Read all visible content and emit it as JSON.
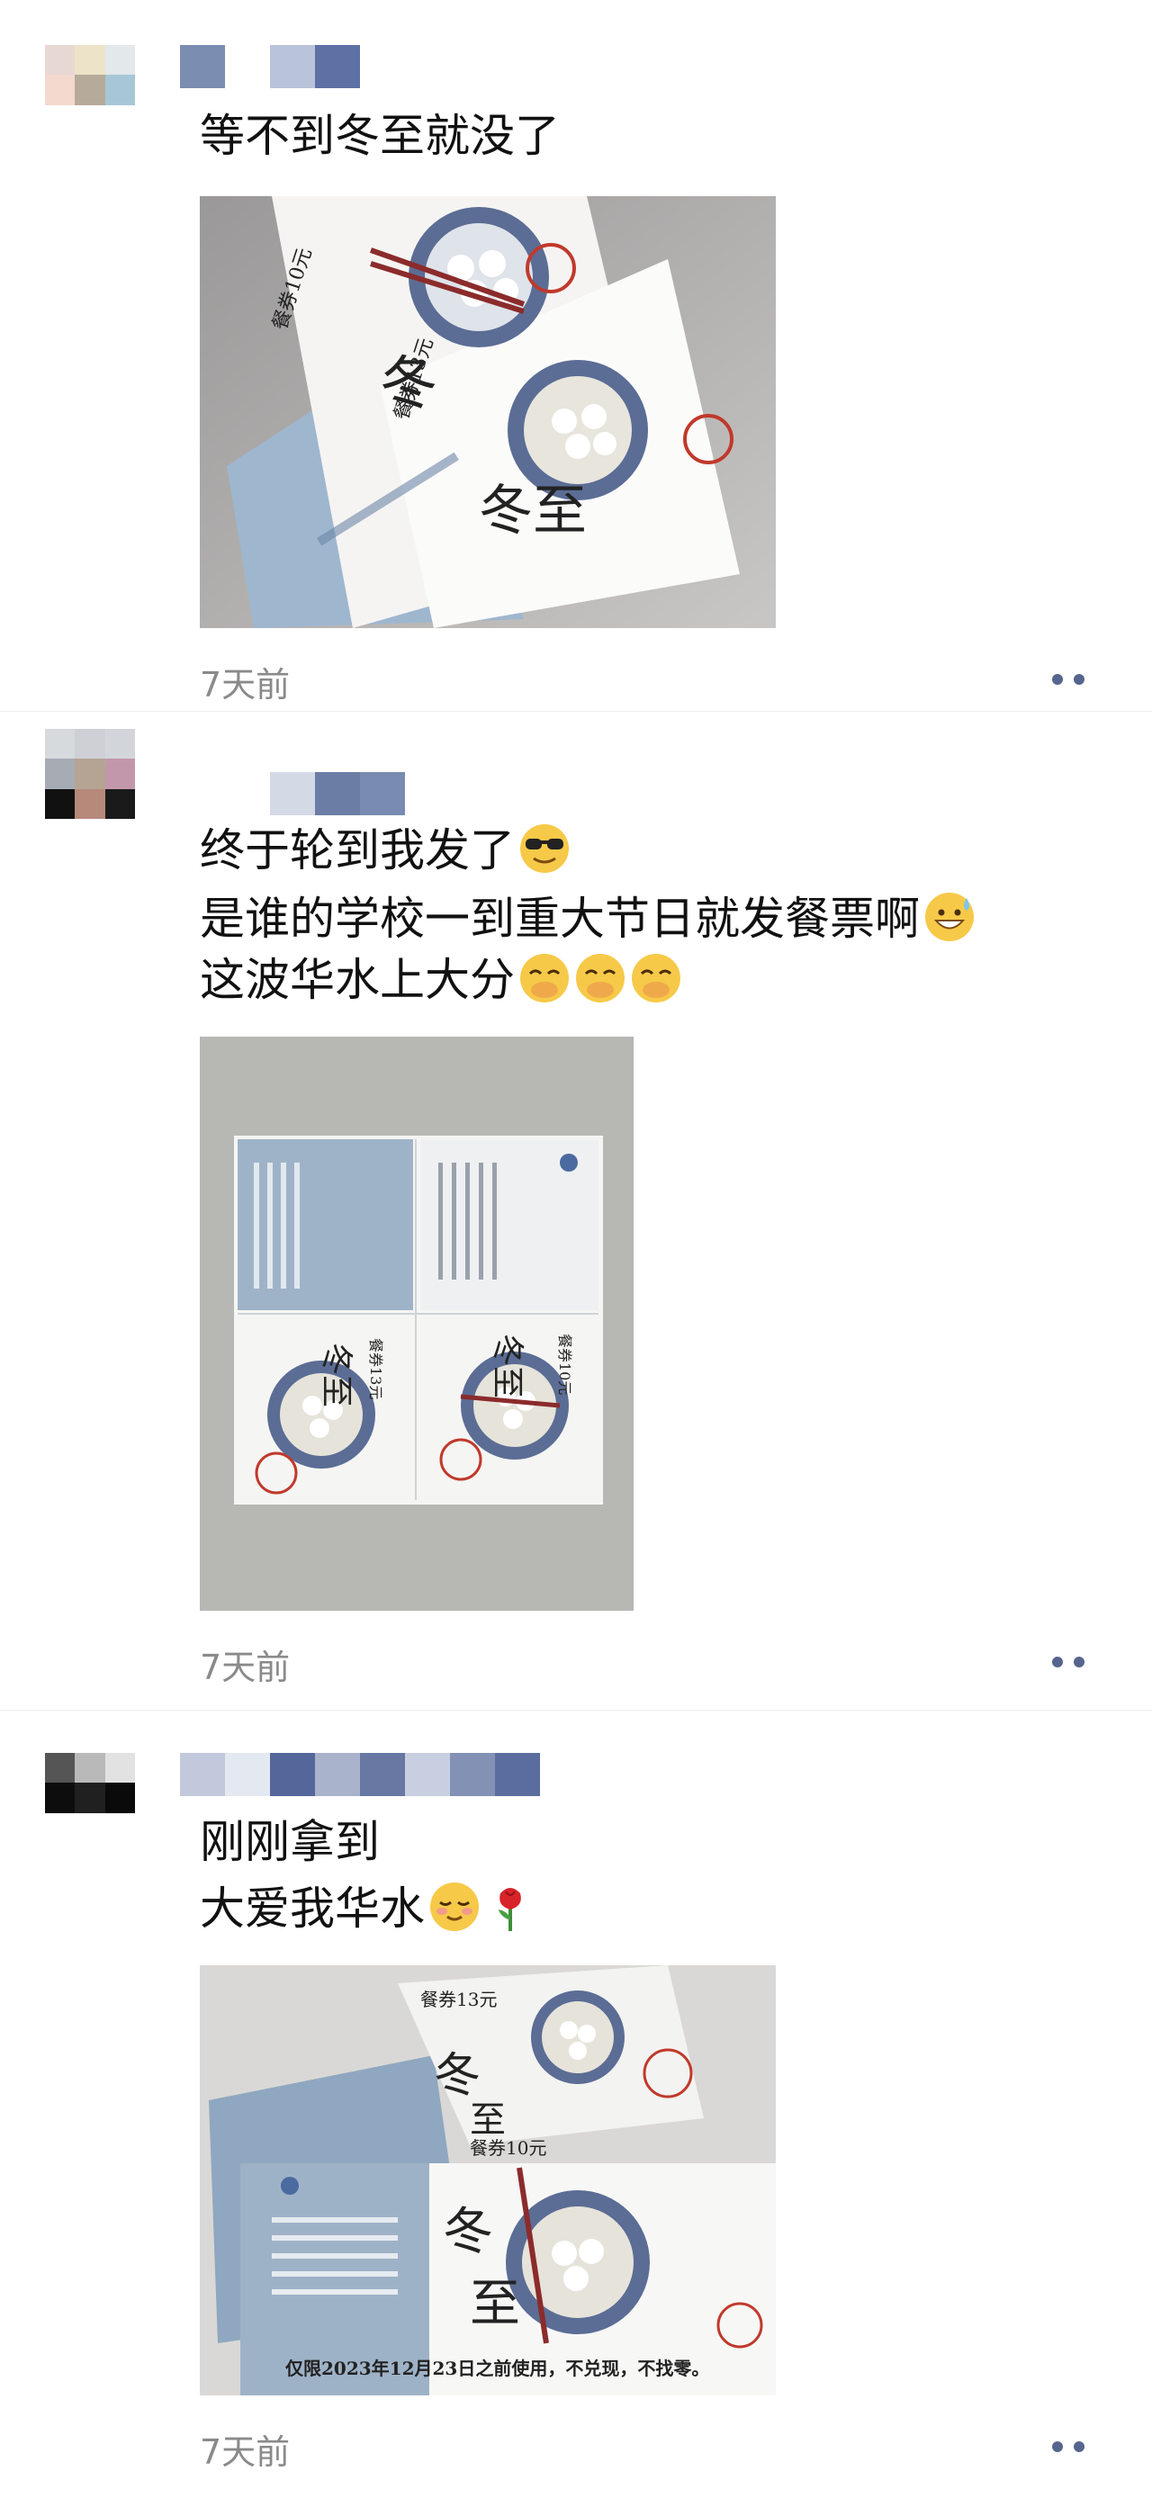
{
  "posts": [
    {
      "lines": [
        "等不到冬至就没了"
      ],
      "timestamp": "7天前"
    },
    {
      "lines": [
        "终于轮到我发了",
        "是谁的学校一到重大节日就发餐票啊",
        "这波华水上大分"
      ],
      "timestamp": "7天前",
      "emojis": [
        "sunglasses-emoji",
        "grin-sweat-emoji",
        "giggle-emoji"
      ]
    },
    {
      "lines": [
        "刚刚拿到",
        "大爱我华水"
      ],
      "timestamp": "7天前",
      "emojis": [
        "blush-emoji",
        "rose-emoji"
      ],
      "ticket_notice": "仅限2023年12月23日之前使用，不兑现，不找零。"
    }
  ],
  "ticket_text": {
    "coupon_10": "餐券10元",
    "coupon_13": "餐券13元",
    "festival": "冬至"
  },
  "colors": {
    "link_blue": "#56658d",
    "timestamp_gray": "#8a8a8a",
    "ticket_blue": "#8fa7c0"
  }
}
